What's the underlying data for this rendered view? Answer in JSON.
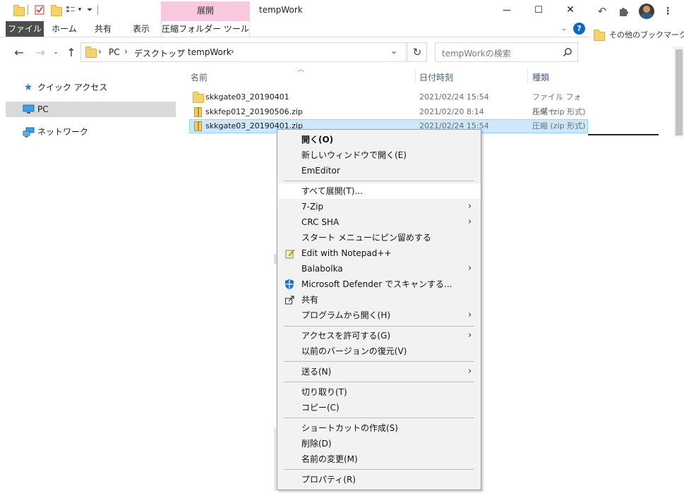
{
  "window": {
    "title": "tempWork",
    "contextual_tab_group": "展開",
    "tabs": [
      {
        "label": "ファイル",
        "active": true
      },
      {
        "label": "ホーム"
      },
      {
        "label": "共有"
      },
      {
        "label": "表示"
      },
      {
        "label": "圧縮フォルダー ツール"
      }
    ],
    "controls": {
      "minimize": "—",
      "maximize": "☐",
      "close": "✕"
    }
  },
  "address": {
    "path": [
      "PC",
      "デスクトップ",
      "tempWork"
    ],
    "search_placeholder": "tempWorkの検索"
  },
  "nav": {
    "items": [
      {
        "label": "クイック アクセス",
        "icon": "star-icon"
      },
      {
        "label": "PC",
        "icon": "monitor-icon",
        "selected": true
      },
      {
        "label": "ネットワーク",
        "icon": "network-icon"
      }
    ]
  },
  "list": {
    "columns": [
      "名前",
      "日付時刻",
      "種類"
    ],
    "rows": [
      {
        "name": "skkgate03_20190401",
        "date": "2021/02/24 15:54",
        "type": "ファイル フォルダー",
        "icon": "folder-icon"
      },
      {
        "name": "skkfep012_20190506.zip",
        "date": "2021/02/20 8:14",
        "type": "圧縮 (zip 形式)",
        "icon": "zip-icon"
      },
      {
        "name": "skkgate03_20190401.zip",
        "date": "2021/02/24 15:54",
        "type": "圧縮 (zip 形式)",
        "icon": "zip-icon",
        "selected": true
      }
    ]
  },
  "browser": {
    "bookmark_label": "その他のブックマーク"
  },
  "context_menu": {
    "items": [
      {
        "label": "開く(O)",
        "bold": true
      },
      {
        "label": "新しいウィンドウで開く(E)"
      },
      {
        "label": "EmEditor"
      },
      {
        "separator": true
      },
      {
        "label": "すべて展開(T)...",
        "highlighted": true
      },
      {
        "label": "7-Zip",
        "submenu": true
      },
      {
        "label": "CRC SHA",
        "submenu": true
      },
      {
        "label": "スタート メニューにピン留めする"
      },
      {
        "label": "Edit with Notepad++",
        "icon": "notepad-icon"
      },
      {
        "label": "Balabolka",
        "submenu": true
      },
      {
        "label": "Microsoft Defender でスキャンする...",
        "icon": "defender-icon"
      },
      {
        "label": "共有",
        "icon": "share-icon"
      },
      {
        "label": "プログラムから開く(H)",
        "submenu": true
      },
      {
        "separator": true
      },
      {
        "label": "アクセスを許可する(G)",
        "submenu": true
      },
      {
        "label": "以前のバージョンの復元(V)"
      },
      {
        "separator": true
      },
      {
        "label": "送る(N)",
        "submenu": true
      },
      {
        "separator": true
      },
      {
        "label": "切り取り(T)"
      },
      {
        "label": "コピー(C)"
      },
      {
        "separator": true
      },
      {
        "label": "ショートカットの作成(S)"
      },
      {
        "label": "削除(D)"
      },
      {
        "label": "名前の変更(M)"
      },
      {
        "separator": true
      },
      {
        "label": "プロパティ(R)"
      }
    ]
  }
}
